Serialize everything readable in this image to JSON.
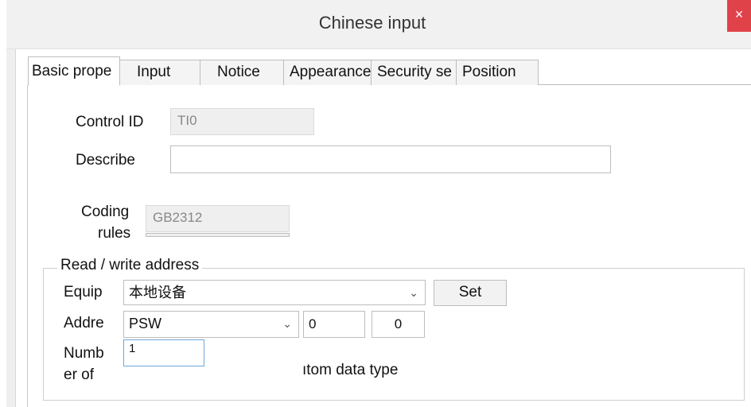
{
  "window": {
    "title": "Chinese input",
    "close_glyph": "×"
  },
  "tabs": [
    {
      "label": "Basic prope"
    },
    {
      "label": "Input"
    },
    {
      "label": "Notice"
    },
    {
      "label": "Appearance"
    },
    {
      "label": "Security se"
    },
    {
      "label": "Position"
    }
  ],
  "basic": {
    "control_id_label": "Control ID",
    "control_id_value": "TI0",
    "describe_label": "Describe",
    "describe_value": "",
    "coding_label_1": "Coding",
    "coding_label_2": "rules",
    "coding_value": "GB2312"
  },
  "rw": {
    "group_title": "Read / write address",
    "equip_label": "Equip",
    "equip_value": "本地设备",
    "set_label": "Set",
    "addr_label": "Addre",
    "addr_type": "PSW",
    "addr_field_1": "0",
    "addr_field_2": "0",
    "number_label_1": "Numb",
    "number_label_2": "er of",
    "number_value": "1",
    "custom_type_text": "ıtom data type"
  }
}
